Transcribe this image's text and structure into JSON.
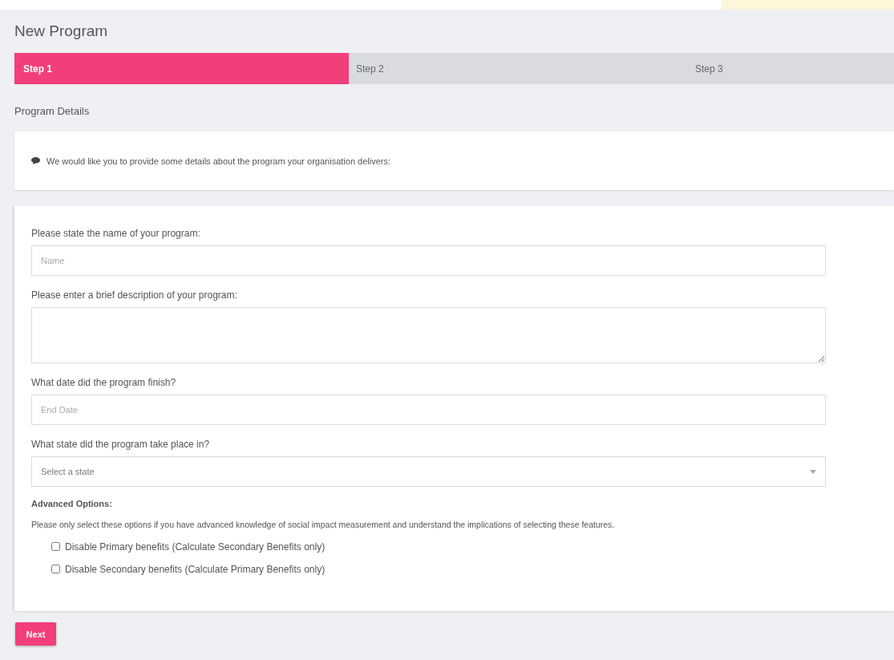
{
  "page_title": "New Program",
  "steps": [
    {
      "label": "Step 1",
      "selected": true
    },
    {
      "label": "Step 2",
      "selected": false
    },
    {
      "label": "Step 3",
      "selected": false
    }
  ],
  "section_title": "Program Details",
  "info": {
    "text": "We would like you to provide some details about the program your organisation delivers:"
  },
  "form": {
    "fields": [
      {
        "kind": "text",
        "label": "Please state the name of your program:",
        "placeholder": "Name"
      },
      {
        "kind": "textarea",
        "label": "Please enter a brief description of your program:"
      },
      {
        "kind": "text",
        "label": "What date did the program finish?",
        "placeholder": "End Date"
      },
      {
        "kind": "select",
        "label": "What state did the program take place in?",
        "placeholder": "Select a state"
      }
    ],
    "advanced_title": "Advanced Options:",
    "advanced_note": "Please only select these options if you have advanced knowledge of social impact measurement and understand the implications of selecting these features.",
    "options": [
      {
        "label": "Disable Primary benefits (Calculate Secondary Benefits only)",
        "checked": false
      },
      {
        "label": "Disable Secondary benefits (Calculate Primary Benefits only)",
        "checked": false
      }
    ]
  },
  "next_button": "Next"
}
